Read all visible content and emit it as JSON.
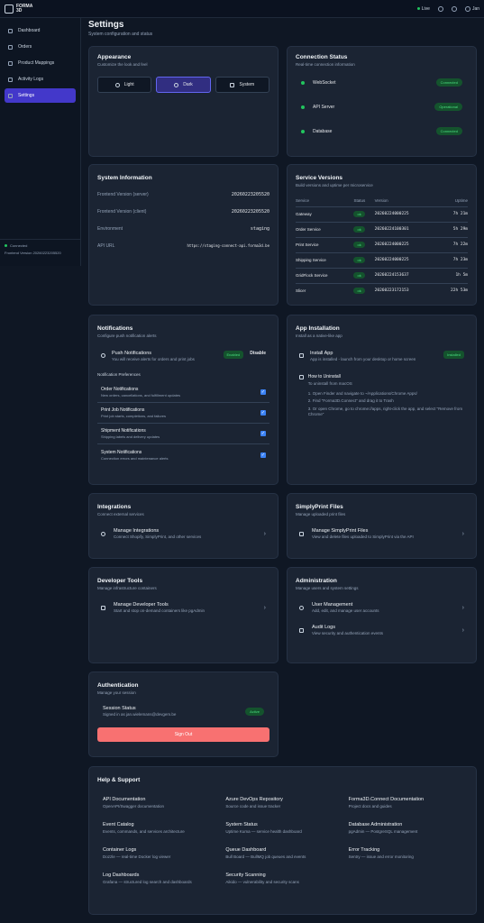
{
  "topbar": {
    "brand": "FORMA 3D",
    "live": "Live",
    "user": "Jan"
  },
  "sidebar": {
    "items": [
      {
        "label": "Dashboard"
      },
      {
        "label": "Orders"
      },
      {
        "label": "Product Mappings"
      },
      {
        "label": "Activity Logs"
      },
      {
        "label": "Settings"
      }
    ],
    "status": "Connected",
    "version": "Frontend Version 20260223205520"
  },
  "page": {
    "title": "Settings",
    "subtitle": "System configuration and status"
  },
  "appearance": {
    "title": "Appearance",
    "subtitle": "Customize the look and feel",
    "light": "Light",
    "dark": "Dark",
    "system": "System"
  },
  "connection": {
    "title": "Connection Status",
    "subtitle": "Real-time connection information",
    "rows": [
      {
        "name": "WebSocket",
        "status": "Connected"
      },
      {
        "name": "API Server",
        "status": "Operational"
      },
      {
        "name": "Database",
        "status": "Connected"
      }
    ]
  },
  "sysinfo": {
    "title": "System Information",
    "rows": [
      {
        "label": "Frontend Version (server)",
        "value": "20260223205520"
      },
      {
        "label": "Frontend Version (client)",
        "value": "20260223205520"
      },
      {
        "label": "Environment",
        "value": "staging"
      },
      {
        "label": "API URL",
        "value": "https://staging-connect-api.forma3d.be"
      }
    ]
  },
  "services": {
    "title": "Service Versions",
    "subtitle": "Build versions and uptime per microservice",
    "headers": [
      "Service",
      "Status",
      "Version",
      "Uptime"
    ],
    "rows": [
      {
        "name": "Gateway",
        "status": "ok",
        "version": "20260224000225",
        "uptime": "7h 21m"
      },
      {
        "name": "Order Service",
        "status": "ok",
        "version": "20260224100301",
        "uptime": "5h 29m"
      },
      {
        "name": "Print Service",
        "status": "ok",
        "version": "20260224000225",
        "uptime": "7h 22m"
      },
      {
        "name": "Shipping Service",
        "status": "ok",
        "version": "20260224000225",
        "uptime": "7h 23m"
      },
      {
        "name": "GridFlock Service",
        "status": "ok",
        "version": "20260224153637",
        "uptime": "1h 5m"
      },
      {
        "name": "Slicer",
        "status": "ok",
        "version": "20260223172153",
        "uptime": "22h 53m"
      }
    ]
  },
  "notifications": {
    "title": "Notifications",
    "subtitle": "Configure push notification alerts",
    "push_title": "Push Notifications",
    "push_desc": "You will receive alerts for orders and print jobs",
    "enabled": "Enabled",
    "disable": "Disable",
    "prefs_title": "Notification Preferences",
    "prefs": [
      {
        "title": "Order Notifications",
        "desc": "New orders, cancellations, and fulfillment updates"
      },
      {
        "title": "Print Job Notifications",
        "desc": "Print job starts, completions, and failures"
      },
      {
        "title": "Shipment Notifications",
        "desc": "Shipping labels and delivery updates"
      },
      {
        "title": "System Notifications",
        "desc": "Connection errors and maintenance alerts"
      }
    ]
  },
  "install": {
    "title": "App Installation",
    "subtitle": "Install as a native-like app",
    "app_title": "Install App",
    "app_desc": "App is installed - launch from your desktop or home screen",
    "installed": "Installed",
    "uninstall_title": "How to Uninstall",
    "uninstall_os": "To uninstall from macOS",
    "steps": [
      "1. Open Finder and navigate to ~/Applications/Chrome Apps/",
      "2. Find \"Forma3D.Connect\" and drag it to Trash",
      "3. Or open Chrome, go to chrome://apps, right-click the app, and select \"Remove from Chrome\""
    ]
  },
  "integrations": {
    "title": "Integrations",
    "subtitle": "Connect external services",
    "item_title": "Manage Integrations",
    "item_desc": "Connect Shopify, SimplyPrint, and other services"
  },
  "simplyprint": {
    "title": "SimplyPrint Files",
    "subtitle": "Manage uploaded print files",
    "item_title": "Manage SimplyPrint Files",
    "item_desc": "View and delete files uploaded to SimplyPrint via the API"
  },
  "devtools": {
    "title": "Developer Tools",
    "subtitle": "Manage infrastructure containers",
    "item_title": "Manage Developer Tools",
    "item_desc": "Start and stop on-demand containers like pgAdmin"
  },
  "admin": {
    "title": "Administration",
    "subtitle": "Manage users and system settings",
    "items": [
      {
        "title": "User Management",
        "desc": "Add, edit, and manage user accounts"
      },
      {
        "title": "Audit Logs",
        "desc": "View security and authentication events"
      }
    ]
  },
  "auth": {
    "title": "Authentication",
    "subtitle": "Manage your session",
    "session_title": "Session Status",
    "session_desc": "Signed in as jan.wielemans@devgem.be",
    "active": "Active",
    "signout": "Sign Out"
  },
  "help": {
    "title": "Help & Support",
    "items": [
      {
        "title": "API Documentation",
        "desc": "OpenAPI/Swagger documentation"
      },
      {
        "title": "Azure DevOps Repository",
        "desc": "Source code and issue tracker"
      },
      {
        "title": "Forma3D.Connect Documentation",
        "desc": "Project docs and guides"
      },
      {
        "title": "Event Catalog",
        "desc": "Events, commands, and services architecture"
      },
      {
        "title": "System Status",
        "desc": "Uptime Kuma — service health dashboard"
      },
      {
        "title": "Database Administration",
        "desc": "pgAdmin — PostgreSQL management"
      },
      {
        "title": "Container Logs",
        "desc": "Dozzle — real-time Docker log viewer"
      },
      {
        "title": "Queue Dashboard",
        "desc": "Bull Board — BullMQ job queues and events"
      },
      {
        "title": "Error Tracking",
        "desc": "Sentry — issue and error monitoring"
      },
      {
        "title": "Log Dashboards",
        "desc": "Grafana — structured log search and dashboards"
      },
      {
        "title": "Security Scanning",
        "desc": "Aikido — vulnerability and security scans"
      }
    ]
  }
}
